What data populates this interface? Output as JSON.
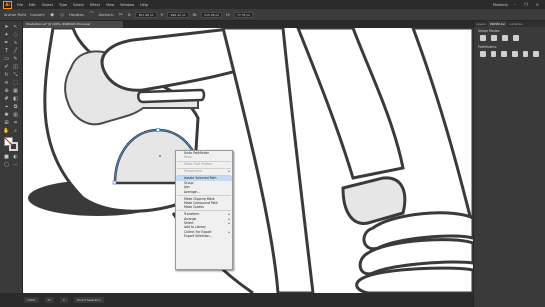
{
  "menubar": {
    "logo": "Ai",
    "items": [
      "File",
      "Edit",
      "Object",
      "Type",
      "Select",
      "Effect",
      "View",
      "Window",
      "Help"
    ],
    "workspace": "Painterly",
    "window_buttons": [
      "–",
      "❐",
      "✕"
    ]
  },
  "controlbar": {
    "selection_label": "Anchor Point",
    "convert_label": "Convert:",
    "handles_label": "Handles:",
    "anchors_label": "Anchors:",
    "x_label": "X:",
    "x_value": "301.48 px",
    "y_label": "Y:",
    "y_value": "996.12 px",
    "w_label": "W:",
    "w_value": "115.06 px",
    "h_label": "H:",
    "h_value": "77.35 px"
  },
  "document": {
    "tab_title": "Illustration.ai* @ 100% (RGB/GPU Preview)"
  },
  "right_panel": {
    "tabs": [
      "Layers",
      "Pathfinder",
      "Libraries"
    ],
    "active_tab": "Pathfinder",
    "shape_modes_label": "Shape Modes:",
    "pathfinders_label": "Pathfinders:",
    "shape_mode_icons": [
      "unite-icon",
      "minus-front-icon",
      "intersect-icon",
      "exclude-icon"
    ],
    "pathfinder_icons": [
      "divide-icon",
      "trim-icon",
      "merge-icon",
      "crop-icon",
      "outline-icon",
      "minus-back-icon"
    ]
  },
  "statusbar": {
    "zoom": "100%",
    "rotation": "0°",
    "artboard": "1",
    "tool": "Direct Selection"
  },
  "context_menu": {
    "items": [
      {
        "label": "Undo Pathfinder",
        "type": "item"
      },
      {
        "label": "Redo",
        "type": "disabled"
      },
      {
        "type": "separator"
      },
      {
        "label": "Make Pixel Perfect",
        "type": "disabled"
      },
      {
        "type": "separator"
      },
      {
        "label": "Perspective",
        "type": "disabled-sub"
      },
      {
        "type": "separator"
      },
      {
        "label": "Isolate Selected Path",
        "type": "highlight"
      },
      {
        "label": "Group",
        "type": "item"
      },
      {
        "label": "Join",
        "type": "item"
      },
      {
        "label": "Average...",
        "type": "item"
      },
      {
        "type": "separator"
      },
      {
        "label": "Make Clipping Mask",
        "type": "item"
      },
      {
        "label": "Make Compound Path",
        "type": "item"
      },
      {
        "label": "Make Guides",
        "type": "item"
      },
      {
        "type": "separator"
      },
      {
        "label": "Transform",
        "type": "sub"
      },
      {
        "label": "Arrange",
        "type": "sub"
      },
      {
        "label": "Select",
        "type": "sub"
      },
      {
        "label": "Add to Library",
        "type": "item"
      },
      {
        "label": "Collect For Export",
        "type": "sub"
      },
      {
        "label": "Export Selection...",
        "type": "item"
      }
    ]
  },
  "colors": {
    "canvas": "#535353",
    "artboard": "#ffffff",
    "shape_fill": "#e6e6e6",
    "outline": "#3a3a3a",
    "selection": "#4b8bd8",
    "shadow": "#3a3a3a"
  }
}
